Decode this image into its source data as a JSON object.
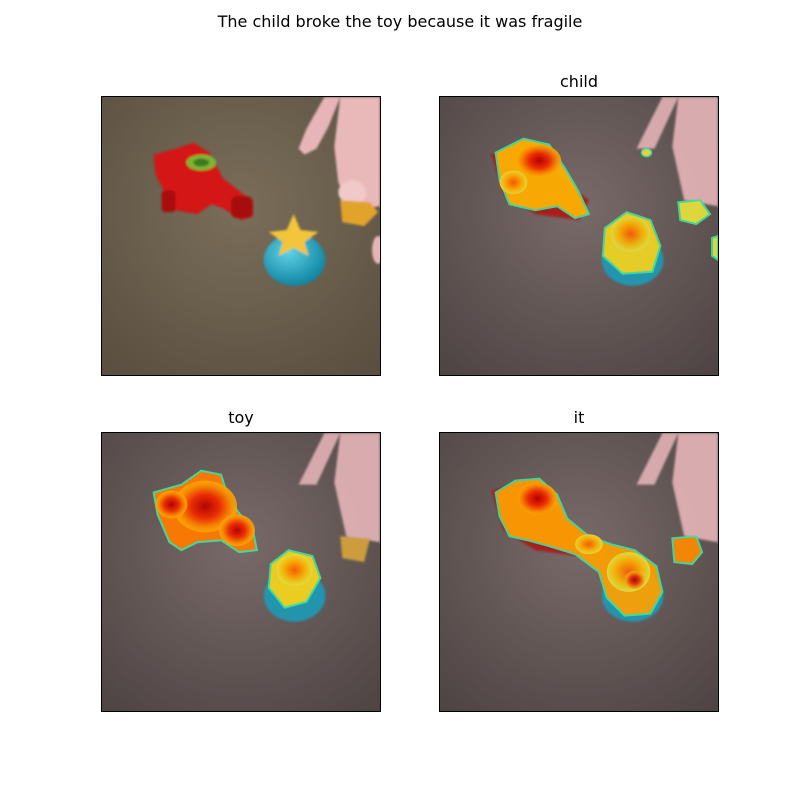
{
  "figure": {
    "suptitle": "The child broke the toy because it was fragile",
    "panels": [
      {
        "title": ""
      },
      {
        "title": "child"
      },
      {
        "title": "toy"
      },
      {
        "title": "it"
      }
    ]
  },
  "colors": {
    "background": "#ffffff",
    "table": "#6e6250",
    "toy_car": "#d41414",
    "ball": "#1fa3c0",
    "star": "#f2c53a",
    "hand": "#e9b7b8",
    "heat_hot": "#c80000",
    "heat_warm": "#ff7a00",
    "heat_mid": "#f6d11b",
    "heat_edge": "#3fe0a0"
  }
}
